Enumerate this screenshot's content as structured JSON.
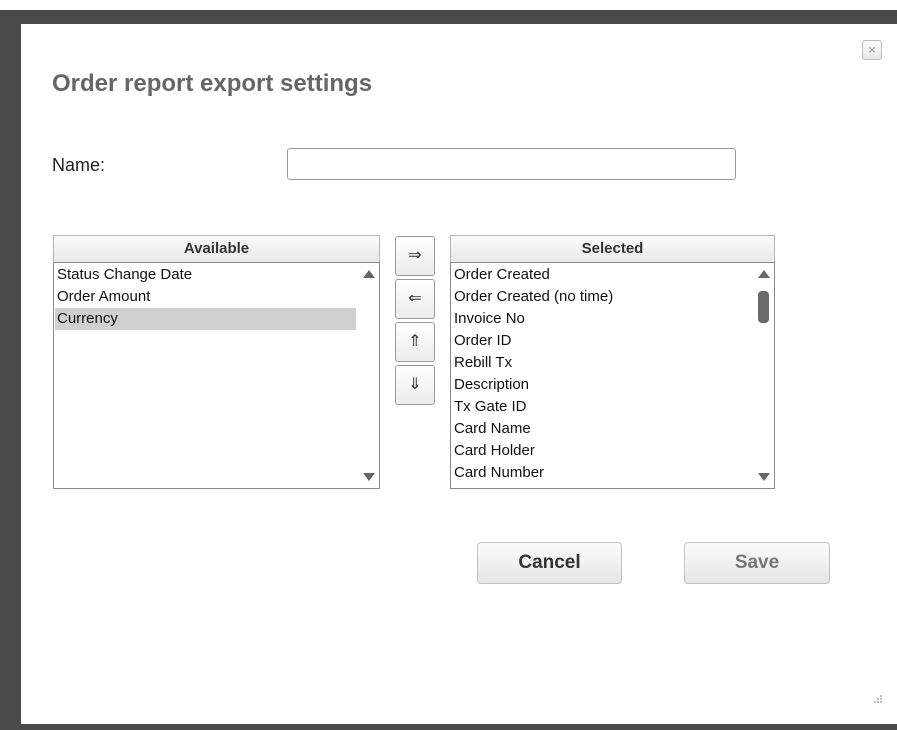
{
  "dialog": {
    "title": "Order report export settings",
    "close_icon": "×"
  },
  "name_field": {
    "label": "Name:",
    "value": "",
    "placeholder": ""
  },
  "available": {
    "header": "Available",
    "items": [
      "Status Change Date",
      "Order Amount",
      "Currency"
    ],
    "selected_item": "Currency"
  },
  "selected": {
    "header": "Selected",
    "items": [
      "Order Created",
      "Order Created (no time)",
      "Invoice No",
      "Order ID",
      "Rebill Tx",
      "Description",
      "Tx Gate ID",
      "Card Name",
      "Card Holder",
      "Card Number"
    ]
  },
  "move_buttons": {
    "add": "⇒",
    "remove": "⇐",
    "up": "⇑",
    "down": "⇓"
  },
  "actions": {
    "cancel": "Cancel",
    "save": "Save"
  },
  "icons": {
    "close": "close-icon",
    "scroll_up": "scroll-up-arrow-icon",
    "scroll_down": "scroll-down-arrow-icon",
    "resize": "resize-grip-icon"
  },
  "colors": {
    "title": "#666666",
    "selection": "#d0d0d0",
    "backdrop": "#4a4a4a",
    "save_text": "#777777",
    "cancel_text": "#333333"
  }
}
